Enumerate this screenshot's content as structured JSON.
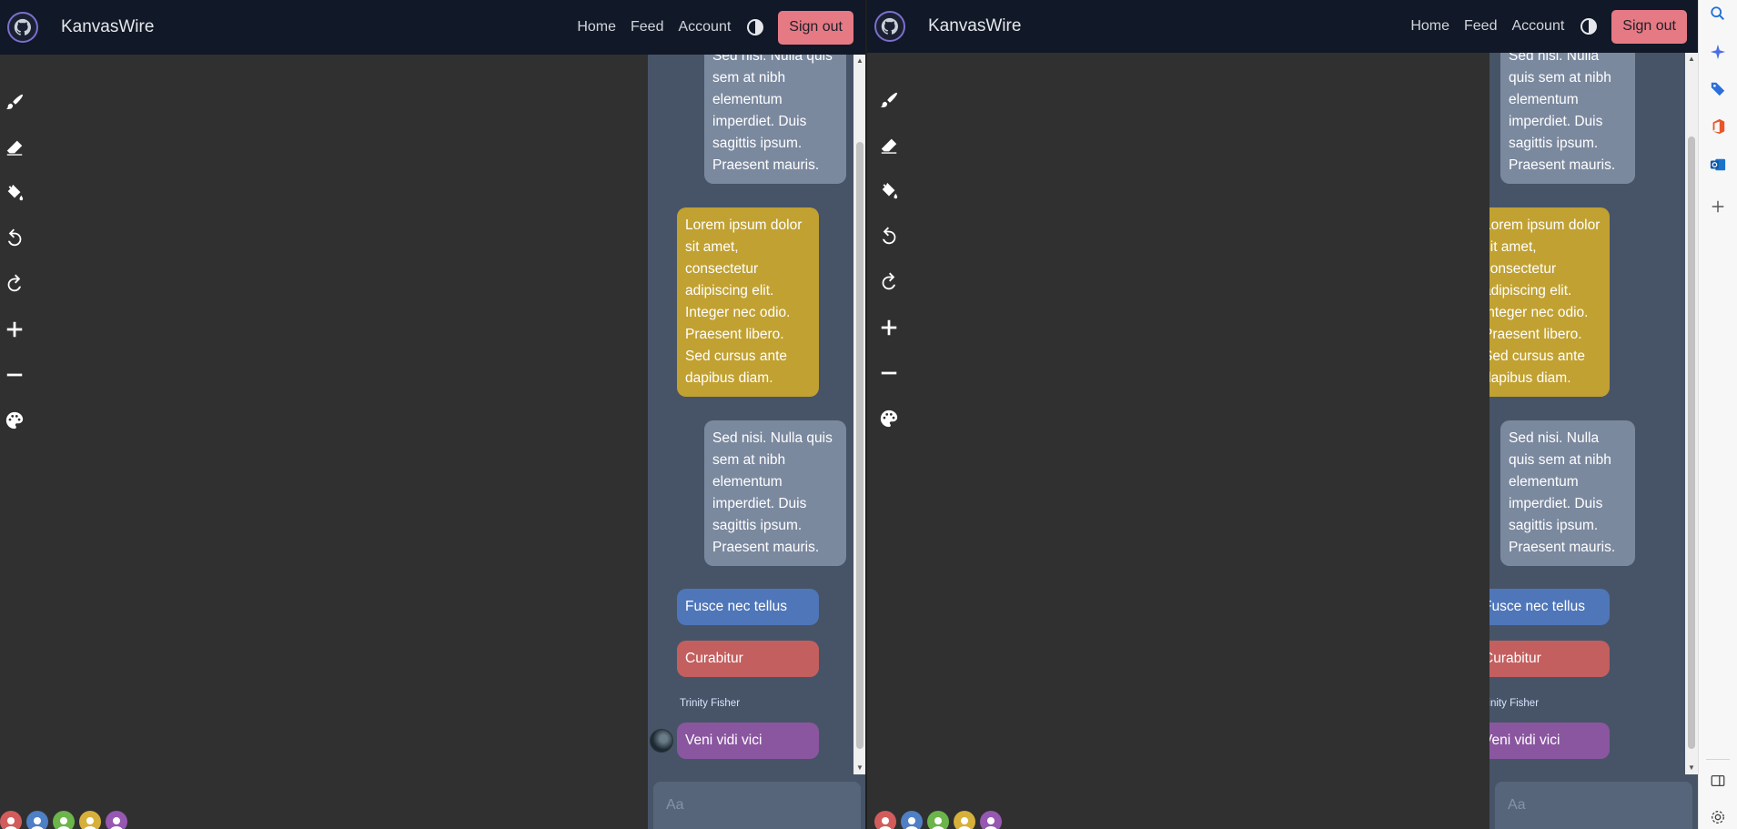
{
  "app": {
    "brand": "KanvasWire",
    "nav": {
      "home": "Home",
      "feed": "Feed",
      "account": "Account",
      "signout": "Sign out"
    }
  },
  "toolbar": [
    "brush-icon",
    "eraser-icon",
    "fill-bucket-icon",
    "undo-icon",
    "redo-icon",
    "zoom-in-icon",
    "zoom-out-icon",
    "palette-icon"
  ],
  "users": [
    {
      "color": "#d25c5c"
    },
    {
      "color": "#4f7fc4"
    },
    {
      "color": "#6bb54a"
    },
    {
      "color": "#d6b03a"
    },
    {
      "color": "#9658b0"
    }
  ],
  "chat": {
    "left": {
      "m1": "Sed nisi. Nulla quis sem at nibh elementum imperdiet. Duis sagittis ipsum. Praesent mauris.",
      "m2": "Lorem ipsum dolor sit amet, consectetur adipiscing elit. Integer nec odio. Praesent libero. Sed cursus ante dapibus diam.",
      "m3": "Sed nisi. Nulla quis sem at nibh elementum imperdiet. Duis sagittis ipsum. Praesent mauris.",
      "m4": "Fusce nec tellus",
      "m5": "Curabitur",
      "sender": "Trinity Fisher",
      "m6": "Veni vidi vici"
    },
    "right": {
      "m1": "Sed nisi. Nulla quis sem at nibh elementum imperdiet. Duis sagittis ipsum. Praesent mauris.",
      "m2": "Lorem ipsum dolor sit amet, consectetur adipiscing elit. Integer nec odio. Praesent libero. Sed cursus ante dapibus diam.",
      "m3": "Sed nisi. Nulla quis sem at nibh elementum imperdiet. Duis sagittis ipsum. Praesent mauris.",
      "m4": "Fusce nec tellus",
      "m5": "Curabitur",
      "sender": "Trinity Fisher",
      "m6": "Veni vidi vici"
    },
    "placeholder": "Aa"
  },
  "colors": {
    "nav": "#111827",
    "signout": "#e57a85",
    "chat_panel": "#475467",
    "bubble_gray": "#7b899f",
    "bubble_gold": "#c1a131",
    "bubble_blue": "#4f76b9",
    "bubble_red": "#c45f5f",
    "bubble_purple": "#8a56a0"
  },
  "browser_sidebar": [
    "search-icon",
    "copilot-icon",
    "tag-icon",
    "office-icon",
    "outlook-icon",
    "add-icon",
    "split-screen-icon",
    "settings-icon"
  ]
}
